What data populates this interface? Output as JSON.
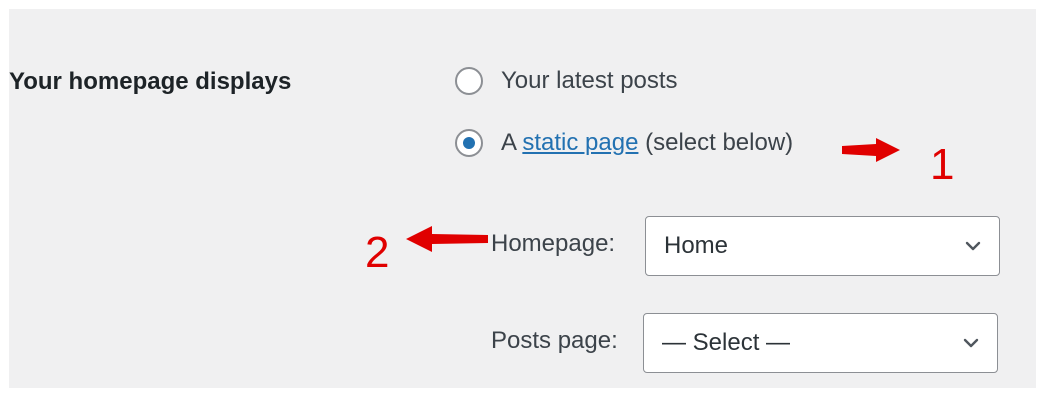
{
  "setting": {
    "label": "Your homepage displays",
    "options": [
      {
        "label": "Your latest posts",
        "selected": false
      },
      {
        "prefix": "A ",
        "link": "static page",
        "suffix": " (select below)",
        "selected": true
      }
    ]
  },
  "fields": {
    "homepage": {
      "label": "Homepage:",
      "value": "Home"
    },
    "posts_page": {
      "label": "Posts page:",
      "value": "— Select —"
    }
  },
  "annotations": {
    "one": "1",
    "two": "2",
    "color": "#e00000"
  },
  "colors": {
    "panel": "#f0f0f1",
    "accent": "#2271b1"
  },
  "icons": {
    "select_chevron": "chevron-down-icon",
    "annotation_arrow": "red-arrow-icon"
  }
}
